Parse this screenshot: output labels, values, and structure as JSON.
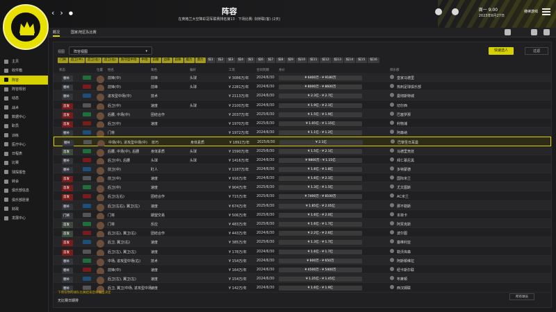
{
  "header": {
    "title": "阵容",
    "subtitle": "在英格兰大空降彩冠军联赛排名第13 · 下场比赛: 剑桥联(客) (2天)",
    "date_line1": "周一 9:00",
    "date_line2": "2023年6月27日",
    "continue_label": "继续游戏"
  },
  "sidebar": {
    "items": [
      {
        "label": "主页",
        "active": false
      },
      {
        "label": "收件箱",
        "active": false
      },
      {
        "label": "阵容",
        "active": true
      },
      {
        "label": "阵容规划",
        "active": false
      },
      {
        "label": "动态",
        "active": false
      },
      {
        "label": "战术",
        "active": false
      },
      {
        "label": "数据中心",
        "active": false
      },
      {
        "label": "职员",
        "active": false
      },
      {
        "label": "训练",
        "active": false
      },
      {
        "label": "医疗中心",
        "active": false
      },
      {
        "label": "日程表",
        "active": false
      },
      {
        "label": "比赛",
        "active": false
      },
      {
        "label": "球探报告",
        "active": false
      },
      {
        "label": "转会",
        "active": false
      },
      {
        "label": "俱乐部信息",
        "active": false
      },
      {
        "label": "俱乐部愿景",
        "active": false
      },
      {
        "label": "财政",
        "active": false
      },
      {
        "label": "发展中心",
        "active": false
      }
    ]
  },
  "subbar": {
    "tabs": [
      "概况",
      "国家/地区队比赛"
    ]
  },
  "main": {
    "filter_label": "视图",
    "view_select": "阵容视图",
    "primary_button": "快速选人",
    "grid_select": "过滤"
  },
  "chips": [
    {
      "label": "门将",
      "yellow": true
    },
    {
      "label": "后卫(中)",
      "yellow": true
    },
    {
      "label": "后卫(左)",
      "yellow": true
    },
    {
      "label": "后卫(右)",
      "yellow": true
    },
    {
      "label": "防守型中场",
      "yellow": true
    },
    {
      "label": "中场",
      "yellow": true
    },
    {
      "label": "前腰",
      "yellow": true
    },
    {
      "label": "边锋",
      "yellow": true
    },
    {
      "label": "前锋",
      "yellow": true
    },
    {
      "label": "能力",
      "yellow": true
    },
    {
      "label": "潜力",
      "yellow": true
    },
    {
      "label": "技1",
      "yellow": false
    },
    {
      "label": "技2",
      "yellow": false
    },
    {
      "label": "技3",
      "yellow": false
    },
    {
      "label": "技4",
      "yellow": false
    },
    {
      "label": "技5",
      "yellow": false
    },
    {
      "label": "技6",
      "yellow": false
    },
    {
      "label": "技7",
      "yellow": false
    },
    {
      "label": "技8",
      "yellow": false
    },
    {
      "label": "技9",
      "yellow": false
    },
    {
      "label": "技10",
      "yellow": false
    },
    {
      "label": "技11",
      "yellow": false
    },
    {
      "label": "技12",
      "yellow": false
    },
    {
      "label": "技13",
      "yellow": false
    },
    {
      "label": "技14",
      "yellow": false
    },
    {
      "label": "技15",
      "yellow": false
    },
    {
      "label": "技16",
      "yellow": false
    }
  ],
  "table": {
    "headers": [
      "状态",
      "位置",
      "姓名",
      "角色",
      "偏好",
      "工资",
      "合同到期",
      "身价",
      "俱乐部"
    ],
    "rows": [
      {
        "tag": "替补",
        "tagc": "n",
        "pos": "前锋(中)",
        "role": "前锋",
        "trait": "头球",
        "wage": "¥ 3086万/年",
        "exp": "2024/6/30",
        "val": "¥ 6400万 - ¥ 9180万",
        "club": "皇家马德里"
      },
      {
        "tag": "替补",
        "tagc": "n",
        "pos": "前锋(中)",
        "role": "前锋",
        "trait": "头球",
        "wage": "¥ 2281万/年",
        "exp": "2024/6/30",
        "val": "¥ 8000万 - ¥ 8600万",
        "club": "热刺足球俱乐部"
      },
      {
        "tag": "替补",
        "tagc": "n",
        "pos": "进攻型中场(中)",
        "role": "技术",
        "trait": "",
        "wage": "¥ 2113万/年",
        "exp": "2024/6/30",
        "val": "¥ 2.3亿 - ¥ 2.7亿",
        "club": "曼彻斯特城"
      },
      {
        "tag": "首发",
        "tagc": "r",
        "pos": "后卫(中)",
        "role": "速度",
        "trait": "头球",
        "wage": "¥ 2100万/年",
        "exp": "2024/6/30",
        "val": "¥ 1.9亿 - ¥ 2.1亿",
        "club": "切尔西"
      },
      {
        "tag": "首发",
        "tagc": "r",
        "pos": "后腰, 中场(中)",
        "role": "团结合作",
        "trait": "",
        "wage": "¥ 2037万/年",
        "exp": "2025/6/30",
        "val": "¥ 1.5亿 - ¥ 1.9亿",
        "club": "巴塞罗那"
      },
      {
        "tag": "首发",
        "tagc": "r",
        "pos": "后卫(中)",
        "role": "速度",
        "trait": "",
        "wage": "¥ 1970万/年",
        "exp": "2025/6/30",
        "val": "¥ 1.05亿 - ¥ 1.15亿",
        "club": "利物浦"
      },
      {
        "tag": "替补",
        "tagc": "n",
        "pos": "门将",
        "role": "",
        "trait": "",
        "wage": "¥ 1972万/年",
        "exp": "2024/6/30",
        "val": "¥ 1.1亿 - ¥ 1.2亿",
        "club": "阿森纳"
      },
      {
        "tag": "替补",
        "tagc": "n",
        "pos": "中场(中), 进攻型中场(中)",
        "role": "技巧",
        "trait": "身体素质",
        "wage": "¥ 1892万/年",
        "exp": "2025/6/30",
        "val": "¥ 2.1亿",
        "club": "巴黎圣日耳曼",
        "hl": true
      },
      {
        "tag": "首发",
        "tagc": "g",
        "pos": "后腰, 中场(中), 后腰",
        "role": "身体素质",
        "trait": "头球",
        "wage": "¥ 1590万/年",
        "exp": "2025/6/30",
        "val": "¥ 1.5亿 - ¥ 2.1亿",
        "club": "马德里竞技"
      },
      {
        "tag": "替补",
        "tagc": "n",
        "pos": "后卫(中), 后腰",
        "role": "头球",
        "trait": "头球",
        "wage": "¥ 1416万/年",
        "exp": "2024/6/30",
        "val": "¥ 9800万 - ¥ 1.15亿",
        "club": "拜仁慕尼黑"
      },
      {
        "tag": "替补",
        "tagc": "n",
        "pos": "前卫(中)",
        "role": "盯人",
        "trait": "",
        "wage": "¥ 1187万/年",
        "exp": "2024/6/30",
        "val": "¥ 1.6亿 - ¥ 1.8亿",
        "club": "多特蒙德"
      },
      {
        "tag": "首发",
        "tagc": "r",
        "pos": "前卫(中)",
        "role": "速度",
        "trait": "",
        "wage": "¥ 916万/年",
        "exp": "2024/6/30",
        "val": "¥ 1.6亿 - ¥ 2.1亿",
        "club": "国际米兰"
      },
      {
        "tag": "首发",
        "tagc": "r",
        "pos": "后卫(中)",
        "role": "速度",
        "trait": "",
        "wage": "¥ 904万/年",
        "exp": "2025/6/30",
        "val": "¥ 1.3亿 - ¥ 1.5亿",
        "club": "尤文图斯"
      },
      {
        "tag": "首发",
        "tagc": "r",
        "pos": "后卫(左右)",
        "role": "团结合作",
        "trait": "",
        "wage": "¥ 715万/年",
        "exp": "2025/6/30",
        "val": "¥ 7400万 - ¥ 8100万",
        "club": "AC米兰"
      },
      {
        "tag": "替补",
        "tagc": "n",
        "pos": "后卫(左右), 翼卫(左)",
        "role": "速度",
        "trait": "",
        "wage": "¥ 674万/年",
        "exp": "2025/6/30",
        "val": "¥ 1.85亿 - ¥ 2.05亿",
        "club": "那不勒斯"
      },
      {
        "tag": "门将",
        "tagc": "n",
        "pos": "门将",
        "role": "期望交易",
        "trait": "",
        "wage": "¥ 506万/年",
        "exp": "2025/6/30",
        "val": "¥ 1.6亿 - ¥ 2.0亿",
        "club": "本菲卡"
      },
      {
        "tag": "首发",
        "tagc": "g",
        "pos": "门将",
        "role": "反应",
        "trait": "",
        "wage": "¥ 483万/年",
        "exp": "2025/6/30",
        "val": "¥ 1.6亿 - ¥ 1.7亿",
        "club": "阿贾克斯"
      },
      {
        "tag": "首发",
        "tagc": "g",
        "pos": "后卫(右), 翼卫(右)",
        "role": "团结合作",
        "trait": "",
        "wage": "¥ 443万/年",
        "exp": "2024/6/30",
        "val": "¥ 2.2亿 - ¥ 2.6亿",
        "club": "波尔图"
      },
      {
        "tag": "首发",
        "tagc": "r",
        "pos": "后卫, 翼卫(右)",
        "role": "速度",
        "trait": "",
        "wage": "¥ 385万/年",
        "exp": "2025/6/30",
        "val": "¥ 1.3亿 - ¥ 1.7亿",
        "club": "塞维利亚"
      },
      {
        "tag": "首发",
        "tagc": "r",
        "pos": "后卫(左), 翼卫(左)",
        "role": "速度",
        "trait": "",
        "wage": "¥ 178万/年",
        "exp": "2024/6/30",
        "val": "¥ 1.6亿 - ¥ 1.7亿",
        "club": "勒沃库森"
      },
      {
        "tag": "替补",
        "tagc": "n",
        "pos": "中场, 进攻型中场(右)",
        "role": "技术",
        "trait": "",
        "wage": "¥ 154万/年",
        "exp": "2024/6/30",
        "val": "¥ 600万 - ¥ 650万",
        "club": "阿斯顿维拉"
      },
      {
        "tag": "替补",
        "tagc": "n",
        "pos": "前锋(中)",
        "role": "速度",
        "trait": "",
        "wage": "¥ 164万/年",
        "exp": "2024/6/30",
        "val": "¥ 4500万 - ¥ 5400万",
        "club": "纽卡斯尔联"
      },
      {
        "tag": "替补",
        "tagc": "n",
        "pos": "后卫(左), 翼卫(左)",
        "role": "速度",
        "trait": "",
        "wage": "¥ 154万/年",
        "exp": "2024/6/30",
        "val": "¥ 1.25亿 - ¥ 1.45亿",
        "club": "布莱顿"
      },
      {
        "tag": "替补",
        "tagc": "n",
        "pos": "后卫, 翼卫/中场, 进攻型中场",
        "role": "速度",
        "trait": "",
        "wage": "¥ 142万/年",
        "exp": "2024/6/30",
        "val": "¥ 1.6亿 - ¥ 1.9亿",
        "club": "西汉姆联"
      }
    ]
  },
  "footer": {
    "note": "下场与你的球队比赛结束后将做出决定",
    "line": "无比赛日期排",
    "select": "所有球员"
  },
  "colors": {
    "accent": "#d7d100",
    "starter_red": "#7a1c1c"
  }
}
